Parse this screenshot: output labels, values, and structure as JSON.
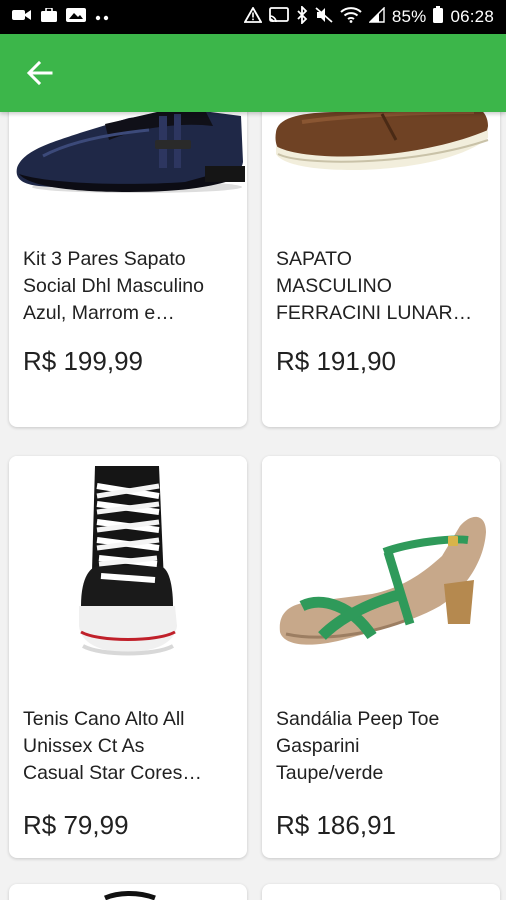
{
  "status_bar": {
    "battery": "85%",
    "time": "06:28",
    "icons": [
      "video-icon",
      "briefcase-icon",
      "image-icon",
      "more-dots-icon",
      "warning-icon",
      "cast-icon",
      "bluetooth-icon",
      "mute-icon",
      "wifi-icon",
      "signal-icon",
      "battery-icon"
    ]
  },
  "app_bar": {
    "back_icon": "arrow-left-icon",
    "color": "#3cb64a"
  },
  "products": [
    {
      "title": "Kit 3 Pares Sapato\nSocial Dhl Masculino\nAzul, Marrom e…",
      "price": "R$ 199,99",
      "image": "navy-dress-shoe"
    },
    {
      "title": "SAPATO\nMASCULINO\nFERRACINI LUNAR…",
      "price": "R$ 191,90",
      "image": "brown-loafer"
    },
    {
      "title": "Tenis Cano Alto All\nUnissex Ct As\nCasual Star Cores…",
      "price": "R$ 79,99",
      "image": "black-high-top-sneaker"
    },
    {
      "title": "Sandália Peep Toe\nGasparini\nTaupe/verde",
      "price": "R$ 186,91",
      "image": "taupe-green-sandal"
    }
  ]
}
